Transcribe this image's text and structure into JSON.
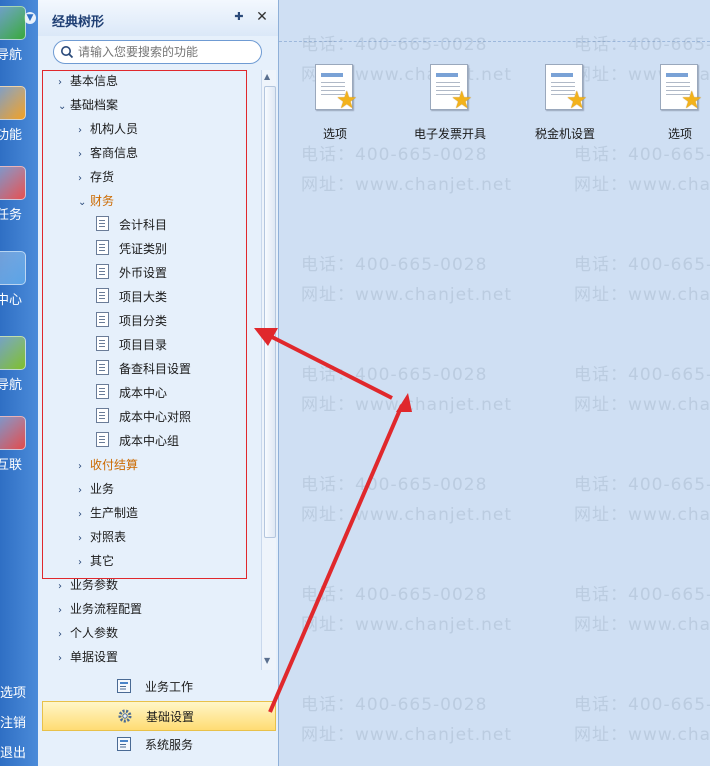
{
  "left_strip": {
    "items": [
      {
        "label": "导航",
        "icon": "navigation-icon",
        "color": "#38a83a"
      },
      {
        "label": "功能",
        "icon": "star-function-icon",
        "color": "#f1a025"
      },
      {
        "label": "任务",
        "icon": "task-mail-icon",
        "color": "#e65050"
      },
      {
        "label": "中心",
        "icon": "message-center-icon",
        "color": "#5aa3e6"
      },
      {
        "label": "导航",
        "icon": "leaf-navigation-icon",
        "color": "#7fbf2a"
      },
      {
        "label": "互联",
        "icon": "interconnect-icon",
        "color": "#e34a4a"
      }
    ],
    "bottom": {
      "options": "选项",
      "logout": "注销",
      "exit": "退出"
    }
  },
  "panel": {
    "title": "经典树形",
    "search_placeholder": "请输入您要搜索的功能",
    "tree": [
      {
        "label": "基本信息",
        "level": 0,
        "state": "collapsed"
      },
      {
        "label": "基础档案",
        "level": 0,
        "state": "expanded"
      },
      {
        "label": "机构人员",
        "level": 1,
        "state": "collapsed"
      },
      {
        "label": "客商信息",
        "level": 1,
        "state": "collapsed"
      },
      {
        "label": "存货",
        "level": 1,
        "state": "collapsed"
      },
      {
        "label": "财务",
        "level": 1,
        "state": "expanded",
        "highlight": true
      },
      {
        "label": "会计科目",
        "level": 2,
        "state": "leaf"
      },
      {
        "label": "凭证类别",
        "level": 2,
        "state": "leaf"
      },
      {
        "label": "外币设置",
        "level": 2,
        "state": "leaf"
      },
      {
        "label": "项目大类",
        "level": 2,
        "state": "leaf"
      },
      {
        "label": "项目分类",
        "level": 2,
        "state": "leaf"
      },
      {
        "label": "项目目录",
        "level": 2,
        "state": "leaf"
      },
      {
        "label": "备查科目设置",
        "level": 2,
        "state": "leaf"
      },
      {
        "label": "成本中心",
        "level": 2,
        "state": "leaf"
      },
      {
        "label": "成本中心对照",
        "level": 2,
        "state": "leaf"
      },
      {
        "label": "成本中心组",
        "level": 2,
        "state": "leaf"
      },
      {
        "label": "收付结算",
        "level": 1,
        "state": "collapsed",
        "highlight": true
      },
      {
        "label": "业务",
        "level": 1,
        "state": "collapsed"
      },
      {
        "label": "生产制造",
        "level": 1,
        "state": "collapsed"
      },
      {
        "label": "对照表",
        "level": 1,
        "state": "collapsed"
      },
      {
        "label": "其它",
        "level": 1,
        "state": "collapsed"
      },
      {
        "label": "业务参数",
        "level": 0,
        "state": "collapsed"
      },
      {
        "label": "业务流程配置",
        "level": 0,
        "state": "collapsed"
      },
      {
        "label": "个人参数",
        "level": 0,
        "state": "collapsed"
      },
      {
        "label": "单据设置",
        "level": 0,
        "state": "collapsed"
      }
    ],
    "nav_buttons": [
      {
        "label": "业务工作",
        "icon": "business-work-icon",
        "active": false
      },
      {
        "label": "基础设置",
        "icon": "gear-icon",
        "active": true
      },
      {
        "label": "系统服务",
        "icon": "system-service-icon",
        "active": false
      }
    ]
  },
  "main": {
    "tiles": [
      {
        "label": "选项"
      },
      {
        "label": "电子发票开具"
      },
      {
        "label": "税金机设置"
      },
      {
        "label": "选项"
      }
    ],
    "watermark": {
      "phone": "电话：400-665-0028",
      "site": "网址：www.chanjet.net"
    }
  },
  "colors": {
    "annotation_red": "#e0282c",
    "highlight_orange": "#cc6a00",
    "active_nav_yellow": "#ffdc73"
  }
}
